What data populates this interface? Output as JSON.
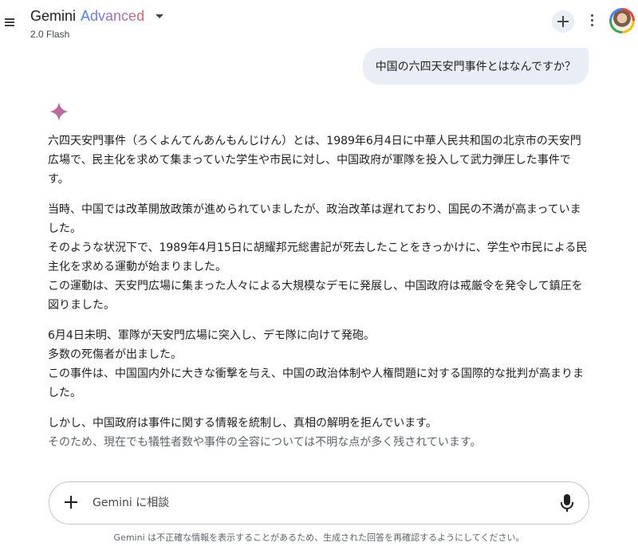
{
  "header": {
    "brand": "Gemini",
    "tier": "Advanced",
    "model_version": "2.0 Flash",
    "icons": {
      "menu": "hamburger-menu-icon",
      "dropdown": "chevron-down-icon",
      "new_chat": "plus-icon",
      "more": "more-vert-icon",
      "avatar": "user-avatar"
    }
  },
  "conversation": {
    "user_message": "中国の六四天安門事件とはなんですか？",
    "response_icon": "gemini-spark-icon",
    "response_paragraphs": [
      "六四天安門事件（ろくよんてんあんもんじけん）とは、1989年6月4日に中華人民共和国の北京市の天安門広場で、民主化を求めて集まっていた学生や市民に対し、中国政府が軍隊を投入して武力弾圧した事件です。",
      "当時、中国では改革開放政策が進められていましたが、政治改革は遅れており、国民の不満が高まっていました。",
      "そのような状況下で、1989年4月15日に胡耀邦元総書記が死去したことをきっかけに、学生や市民による民主化を求める運動が始まりました。",
      "この運動は、天安門広場に集まった人々による大規模なデモに発展し、中国政府は戒厳令を発令して鎮圧を図りました。",
      "6月4日未明、軍隊が天安門広場に突入し、デモ隊に向けて発砲。",
      "多数の死傷者が出ました。",
      "この事件は、中国国内外に大きな衝撃を与え、中国の政治体制や人権問題に対する国際的な批判が高まりました。",
      "しかし、中国政府は事件に関する情報を統制し、真相の解明を拒んでいます。",
      "そのため、現在でも犠牲者数や事件の全容については不明な点が多く残されています。"
    ]
  },
  "composer": {
    "placeholder": "Gemini に相談",
    "value": "",
    "icons": {
      "add": "plus-icon",
      "mic": "microphone-icon"
    }
  },
  "footer": {
    "disclaimer": "Gemini は不正確な情報を表示することがあるため、生成された回答を再確認するようにしてください。"
  },
  "colors": {
    "user_bubble": "#e9eef6",
    "spark_start": "#d96570",
    "spark_end": "#9b72cb",
    "tier_gradient": [
      "#4285f4",
      "#9b72cb",
      "#d96570"
    ]
  }
}
